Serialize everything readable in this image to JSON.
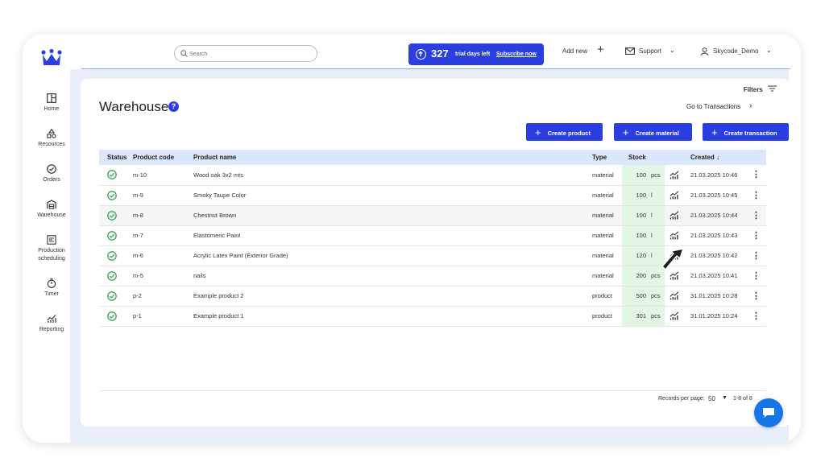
{
  "topbar": {
    "search_placeholder": "Search",
    "trial_count": "327",
    "trial_text": "trial days left",
    "subscribe": "Subscribe now",
    "add_new": "Add new",
    "support": "Support",
    "user": "Skycode_Demo"
  },
  "sidebar": {
    "items": [
      {
        "label": "Home",
        "icon": "home-icon"
      },
      {
        "label": "Resources",
        "icon": "resources-icon"
      },
      {
        "label": "Orders",
        "icon": "orders-icon"
      },
      {
        "label": "Warehouse",
        "icon": "warehouse-icon"
      },
      {
        "label": "Production",
        "label2": "scheduling",
        "icon": "production-icon"
      },
      {
        "label": "Timer",
        "icon": "timer-icon"
      },
      {
        "label": "Reporting",
        "icon": "reporting-icon"
      }
    ]
  },
  "page": {
    "filters": "Filters",
    "title": "Warehouse",
    "help": "?",
    "go_to": "Go to Transactions",
    "buttons": {
      "create_product": "Create product",
      "create_material": "Create material",
      "create_transaction": "Create transaction"
    }
  },
  "table": {
    "headers": {
      "status": "Status",
      "code": "Product code",
      "name": "Product name",
      "type": "Type",
      "stock": "Stock",
      "created": "Created ↓"
    },
    "rows": [
      {
        "code": "m-10",
        "name": "Wood oak 3x2 mts",
        "type": "material",
        "qty": "100",
        "unit": "pcs",
        "created": "21.03.2025 10:46"
      },
      {
        "code": "m-9",
        "name": "Smoky Taupe Color",
        "type": "material",
        "qty": "100",
        "unit": "l",
        "created": "21.03.2025 10:45"
      },
      {
        "code": "m-8",
        "name": "Chestnut Brown",
        "type": "material",
        "qty": "100",
        "unit": "l",
        "created": "21.03.2025 10:44"
      },
      {
        "code": "m-7",
        "name": "Elastomeric Paint",
        "type": "material",
        "qty": "100",
        "unit": "l",
        "created": "21.03.2025 10:43"
      },
      {
        "code": "m-6",
        "name": "Acrylic Latex Paint (Exterior Grade)",
        "type": "material",
        "qty": "120",
        "unit": "l",
        "created": "21.03.2025 10:42"
      },
      {
        "code": "m-5",
        "name": "nails",
        "type": "material",
        "qty": "200",
        "unit": "pcs",
        "created": "21.03.2025 10:41"
      },
      {
        "code": "p-2",
        "name": "Example product 2",
        "type": "product",
        "qty": "500",
        "unit": "pcs",
        "created": "31.01.2025 10:28"
      },
      {
        "code": "p-1",
        "name": "Example product 1",
        "type": "product",
        "qty": "301",
        "unit": "pcs",
        "created": "31.01.2025 10:24"
      }
    ]
  },
  "footer": {
    "records_label": "Records per page:",
    "records_value": "50",
    "pagination": "1-8 of 8"
  },
  "colors": {
    "accent": "#2b3fe0",
    "status_ok": "#34a853",
    "stock_bg": "#e3f5e3",
    "header_bg": "#dbe8fb",
    "chat": "#1676e8"
  }
}
